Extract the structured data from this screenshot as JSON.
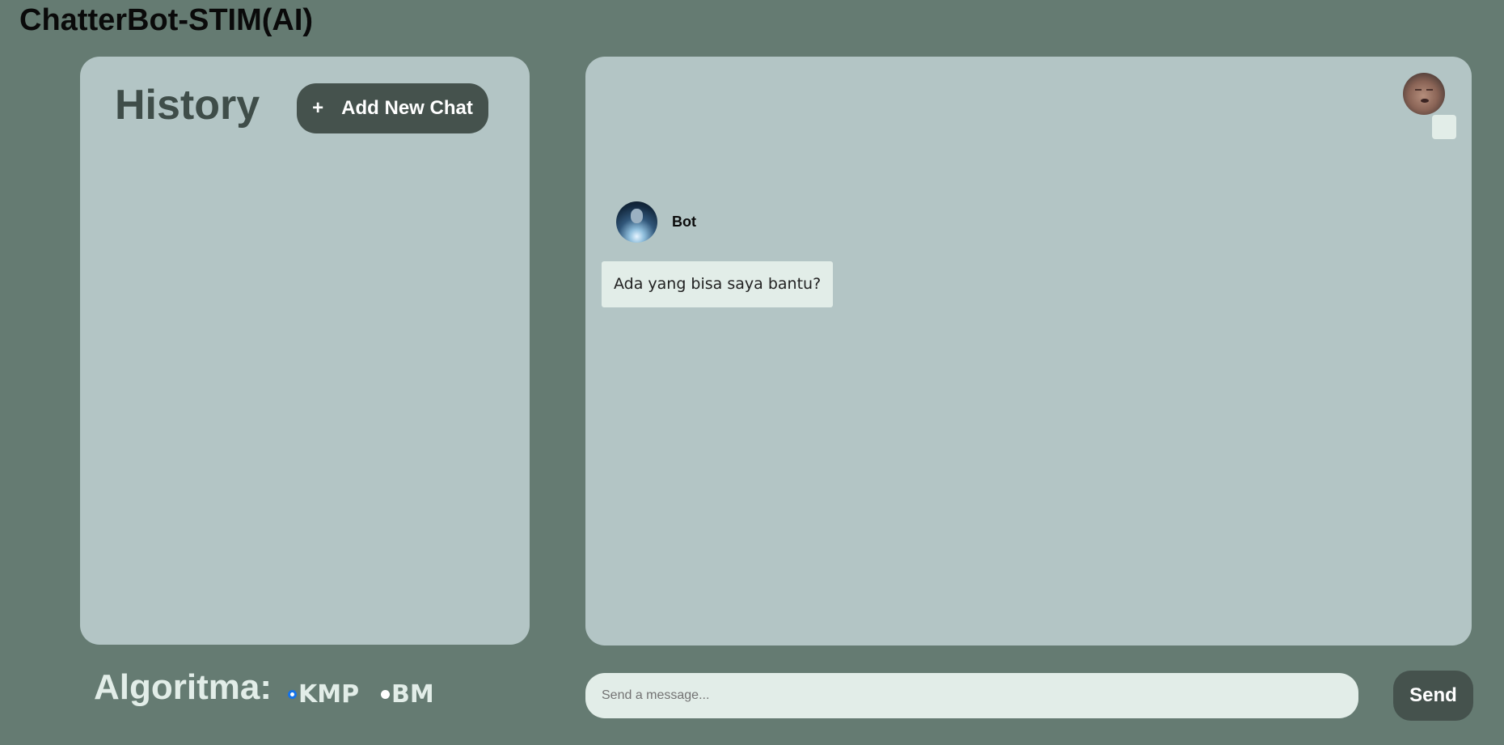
{
  "app": {
    "title": "ChatterBot-STIM(AI)"
  },
  "history": {
    "title": "History",
    "add_button_icon": "plus-icon",
    "add_button_icon_glyph": "+",
    "add_button_label": "Add New Chat",
    "items": []
  },
  "chat": {
    "user_avatar": "user-avatar-photo",
    "messages": [
      {
        "sender": "Bot",
        "avatar": "robot-avatar",
        "text": "Ada yang bisa saya bantu?"
      }
    ]
  },
  "algorithm": {
    "label": "Algoritma:",
    "options": [
      {
        "label": "KMP",
        "selected": true
      },
      {
        "label": "BM",
        "selected": false
      }
    ]
  },
  "composer": {
    "placeholder": "Send a message...",
    "value": "",
    "send_label": "Send"
  },
  "colors": {
    "background": "#657b72",
    "panel": "#b3c5c5",
    "button": "#45524d",
    "light": "#e2ede8",
    "radio_accent": "#1673e8"
  }
}
